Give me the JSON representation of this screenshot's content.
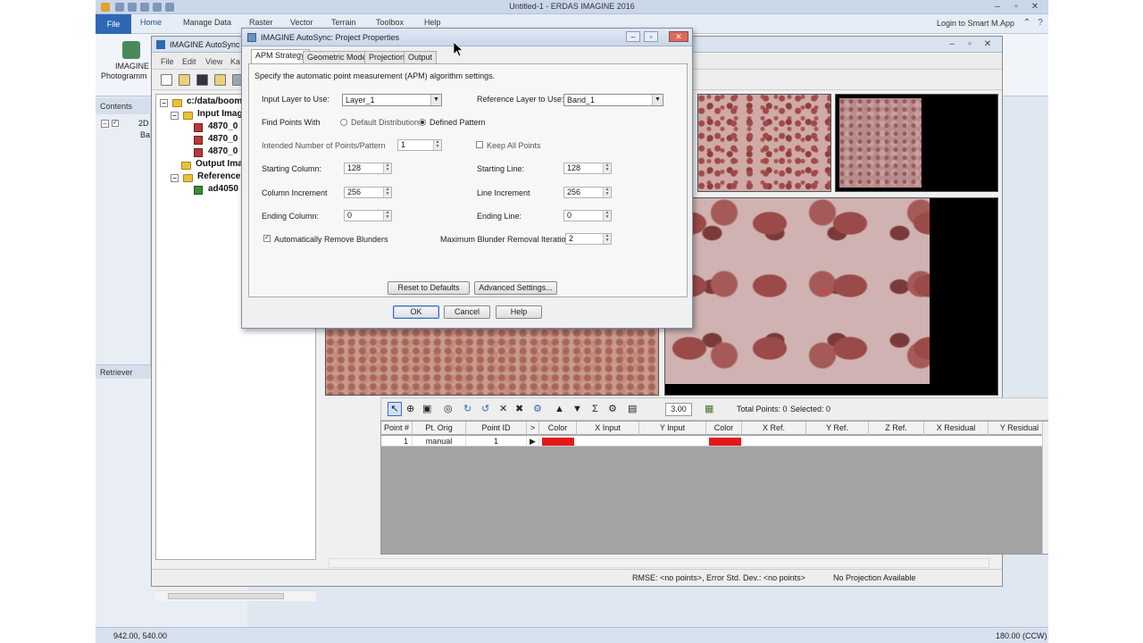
{
  "app": {
    "title": "Untitled-1 - ERDAS IMAGINE 2016",
    "file_tab": "File",
    "tabs": [
      "Home",
      "Manage Data",
      "Raster",
      "Vector",
      "Terrain",
      "Toolbox",
      "Help"
    ],
    "login": "Login to Smart M.App",
    "ribbon_label_photogrammetry": "Photogramm",
    "ribbon_label_imagine": "IMAGINE"
  },
  "left_panels": {
    "contents": "Contents",
    "retriever": "Retriever",
    "contents_items": [
      "2D",
      "Ba"
    ]
  },
  "inner_window": {
    "title": "IMAGINE AutoSync",
    "menu": [
      "File",
      "Edit",
      "View",
      "Ka"
    ]
  },
  "tree": {
    "root": "c:/data/boomi",
    "input_images": "Input Imag",
    "input_items": [
      "4870_0",
      "4870_0",
      "4870_0"
    ],
    "output_images": "Output Imag",
    "reference": "Reference",
    "reference_item": "ad4050"
  },
  "gcp": {
    "zoom": "3.00",
    "total_points": "Total Points: 0",
    "selected": "Selected: 0",
    "columns": [
      "Point #",
      "Pt. Orig",
      "Point ID",
      ">",
      "Color",
      "X Input",
      "Y Input",
      "Color",
      "X Ref.",
      "Y Ref.",
      "Z Ref.",
      "X Residual",
      "Y Residual"
    ],
    "row": {
      "point_num": "1",
      "orig": "manual",
      "point_id": "1",
      "marker": "▶"
    },
    "input_color": "#e31a1a",
    "ref_color": "#e31a1a"
  },
  "status": {
    "rmse": "RMSE:  <no points>, Error Std. Dev.: <no points>",
    "projection": "No Projection Available",
    "coords": "942.00, 540.00",
    "rotation": "180.00 (CCW)"
  },
  "dialog": {
    "title": "IMAGINE AutoSync: Project Properties",
    "tabs": [
      "APM Strategy",
      "Geometric Model",
      "Projection",
      "Output"
    ],
    "description": "Specify the automatic point measurement (APM) algorithm settings.",
    "input_layer_label": "Input Layer to Use:",
    "input_layer_value": "Layer_1",
    "reference_layer_label": "Reference Layer to Use:",
    "reference_layer_value": "Band_1",
    "find_points_label": "Find Points With",
    "default_distribution": "Default Distribution",
    "defined_pattern": "Defined Pattern",
    "intended_points_label": "Intended Number of Points/Pattern",
    "intended_points_value": "1",
    "keep_all_points": "Keep All Points",
    "starting_column_label": "Starting Column:",
    "starting_column_value": "128",
    "starting_line_label": "Starting Line:",
    "starting_line_value": "128",
    "column_increment_label": "Column Increment",
    "column_increment_value": "256",
    "line_increment_label": "Line Increment",
    "line_increment_value": "256",
    "ending_column_label": "Ending Column:",
    "ending_column_value": "0",
    "ending_line_label": "Ending Line:",
    "ending_line_value": "0",
    "auto_remove_blunders": "Automatically Remove Blunders",
    "max_blunder_label": "Maximum Blunder Removal Iterations:",
    "max_blunder_value": "2",
    "reset_defaults": "Reset to Defaults",
    "advanced_settings": "Advanced Settings...",
    "ok": "OK",
    "cancel": "Cancel",
    "help": "Help"
  }
}
